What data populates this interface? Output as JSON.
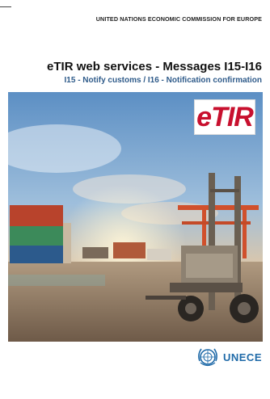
{
  "header": {
    "organization": "UNITED NATIONS ECONOMIC COMMISSION FOR EUROPE"
  },
  "document": {
    "title": "eTIR web services - Messages I15-I16",
    "subtitle": "I15 - Notify customs / I16 - Notification confirmation"
  },
  "cover_image": {
    "badge_text": "eTIR",
    "badge_color": "#c8102e"
  },
  "footer": {
    "logo_text": "UNECE",
    "logo_color": "#1f6aa8"
  }
}
